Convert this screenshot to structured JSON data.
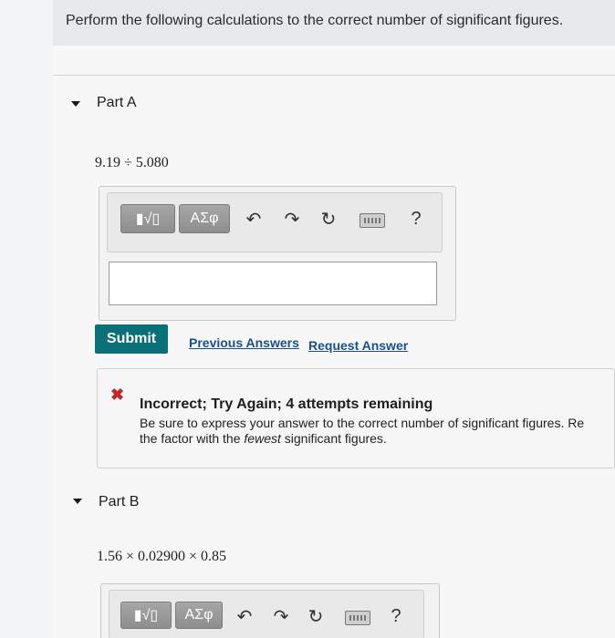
{
  "instruction": "Perform the following calculations to the correct number of significant figures.",
  "part_a": {
    "label": "Part A",
    "expression": "9.19 ÷ 5.080",
    "toolbar": {
      "template_label": "▮√▯",
      "greek_label": "ΑΣφ",
      "undo_icon": "undo-icon",
      "redo_icon": "redo-icon",
      "reset_icon": "reset-icon",
      "keyboard_icon": "keyboard-icon",
      "help_label": "?"
    },
    "answer_value": "",
    "submit_label": "Submit",
    "previous_answers_label": "Previous Answers",
    "request_answer_label": "Request Answer",
    "feedback": {
      "title": "Incorrect; Try Again; 4 attempts remaining",
      "line1": "Be sure to express your answer to the correct number of significant figures. Re",
      "line2_prefix": "the factor with the ",
      "line2_emph": "fewest",
      "line2_suffix": " significant figures."
    }
  },
  "part_b": {
    "label": "Part B",
    "expression": "1.56 × 0.02900 × 0.85",
    "toolbar": {
      "template_label": "▮√▯",
      "greek_label": "ΑΣφ",
      "help_label": "?"
    }
  },
  "colors": {
    "submit_bg": "#0b6f77",
    "link": "#1b4f8a",
    "error": "#c0262d",
    "header_bg": "#e6e9ec"
  }
}
